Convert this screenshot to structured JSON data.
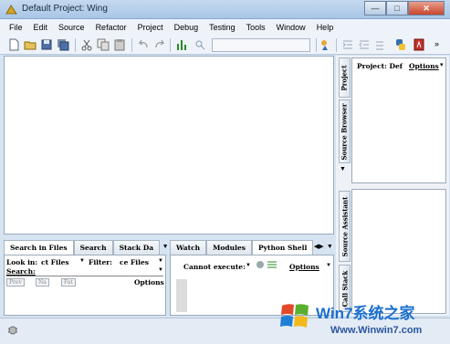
{
  "window": {
    "title": "Default Project: Wing",
    "minimize_glyph": "—",
    "maximize_glyph": "□",
    "close_glyph": "✕"
  },
  "menu": [
    "File",
    "Edit",
    "Source",
    "Refactor",
    "Project",
    "Debug",
    "Testing",
    "Tools",
    "Window",
    "Help"
  ],
  "toolbar": {
    "icons": [
      "new-file-icon",
      "open-folder-icon",
      "save-icon",
      "save-all-icon",
      "cut-icon",
      "copy-icon",
      "paste-icon",
      "undo-icon",
      "redo-icon",
      "chart-icon",
      "search-toggle-icon",
      "goto-icon",
      "indent-icon",
      "outdent-icon",
      "python-icon",
      "pdf-icon"
    ],
    "search_value": ""
  },
  "right_panel": {
    "tabs": [
      "Project",
      "Source Browser",
      "Source Assistant",
      "Call Stack"
    ],
    "project_label": "Project: Def",
    "options_label": "Options"
  },
  "search_panel": {
    "tabs": [
      "Search in Files",
      "Search",
      "Stack Da"
    ],
    "look_in_label": "Look in:",
    "look_in_value": "ct Files",
    "filter_label": "Filter:",
    "filter_value": "ce Files",
    "search_label": "Search:",
    "buttons": [
      "Prev",
      "Na",
      "Fat"
    ],
    "options_label": "Options"
  },
  "shell_panel": {
    "tabs": [
      "Watch",
      "Modules",
      "Python Shell"
    ],
    "status_text": "Cannot execute:",
    "options_label": "Options"
  },
  "watermark": {
    "title": "Win7系统之家",
    "url": "Www.Winwin7.com"
  },
  "colors": {
    "window_bg": "#d6e4f2",
    "accent_blue": "#1b6fcf",
    "close_red": "#c8452c"
  }
}
